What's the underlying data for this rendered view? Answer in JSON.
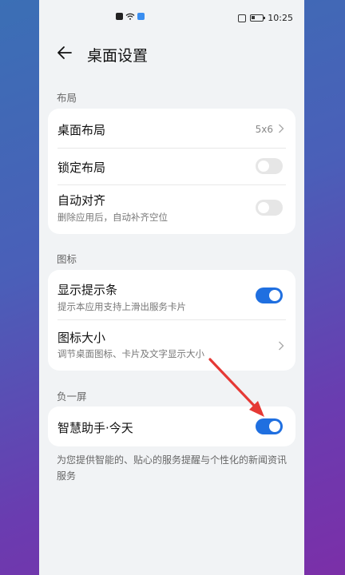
{
  "statusbar": {
    "time": "10:25"
  },
  "header": {
    "title": "桌面设置"
  },
  "sections": {
    "layout": {
      "label": "布局",
      "items": [
        {
          "label": "桌面布局",
          "value": "5x6"
        },
        {
          "label": "锁定布局",
          "toggle": "off"
        },
        {
          "label": "自动对齐",
          "sub": "删除应用后，自动补齐空位",
          "toggle": "off"
        }
      ]
    },
    "icons": {
      "label": "图标",
      "items": [
        {
          "label": "显示提示条",
          "sub": "提示本应用支持上滑出服务卡片",
          "toggle": "on"
        },
        {
          "label": "图标大小",
          "sub": "调节桌面图标、卡片及文字显示大小"
        }
      ]
    },
    "minus_one": {
      "label": "负一屏",
      "items": [
        {
          "label": "智慧助手·今天",
          "toggle": "on"
        }
      ],
      "description": "为您提供智能的、贴心的服务提醒与个性化的新闻资讯服务"
    }
  },
  "colors": {
    "accent": "#1f6fe0",
    "annotation_arrow": "#e53935"
  }
}
